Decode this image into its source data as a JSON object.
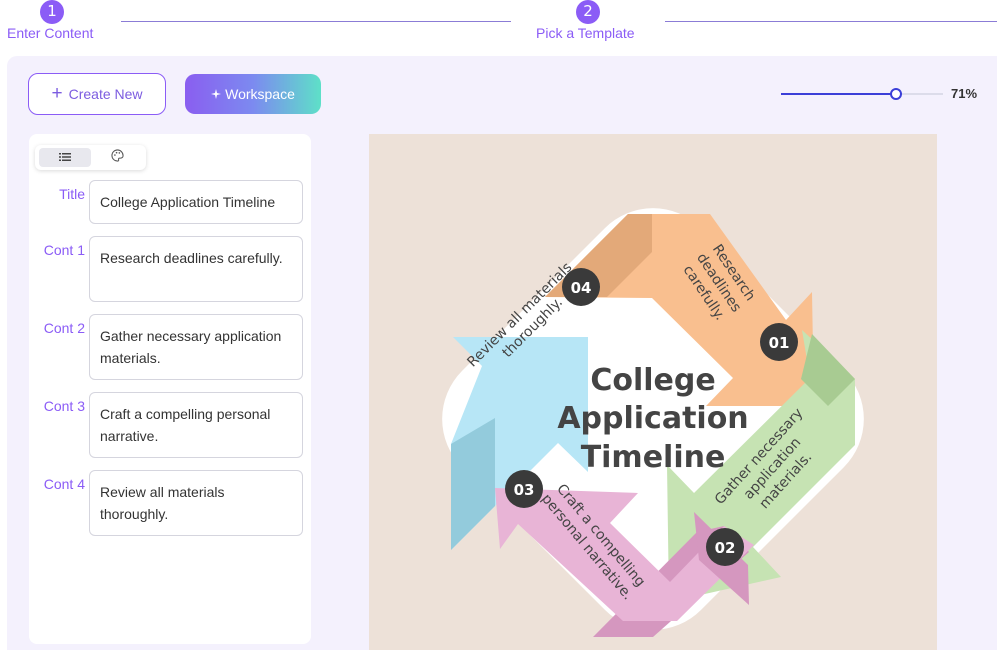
{
  "stepper": {
    "steps": [
      {
        "number": "1",
        "label": "Enter Content"
      },
      {
        "number": "2",
        "label": "Pick a Template"
      }
    ]
  },
  "toolbar": {
    "create_new_label": "Create New",
    "workspace_label": "Workspace",
    "zoom_value": "71%",
    "zoom_fraction": 0.71
  },
  "sidebar": {
    "toggle_icons": [
      "list-icon",
      "palette-icon"
    ],
    "fields": [
      {
        "label": "Title",
        "value": "College Application Timeline"
      },
      {
        "label": "Cont 1",
        "value": "Research deadlines carefully."
      },
      {
        "label": "Cont 2",
        "value": "Gather necessary application materials."
      },
      {
        "label": "Cont 3",
        "value": "Craft a compelling personal narrative."
      },
      {
        "label": "Cont 4",
        "value": "Review all materials thoroughly."
      }
    ]
  },
  "infographic": {
    "title_lines": [
      "College",
      "Application",
      "Timeline"
    ],
    "items": [
      {
        "number": "01",
        "lines": [
          "Research",
          "deadlines",
          "carefully."
        ],
        "color": "#f9bf8f",
        "shade": "#e3a979"
      },
      {
        "number": "02",
        "lines": [
          "Gather necessary",
          "application",
          "materials."
        ],
        "color": "#c6e3b3",
        "shade": "#a8cb92"
      },
      {
        "number": "03",
        "lines": [
          "Craft a compelling",
          "personal narrative."
        ],
        "color": "#e8b4d6",
        "shade": "#d597bf"
      },
      {
        "number": "04",
        "lines": [
          "Review all materials",
          "thoroughly."
        ],
        "color": "#b7e6f6",
        "shade": "#93cbdc"
      }
    ],
    "colors": {
      "background": "#ede1d8",
      "badge": "#3a3a3a",
      "text": "#444444",
      "title": "#444444"
    }
  }
}
